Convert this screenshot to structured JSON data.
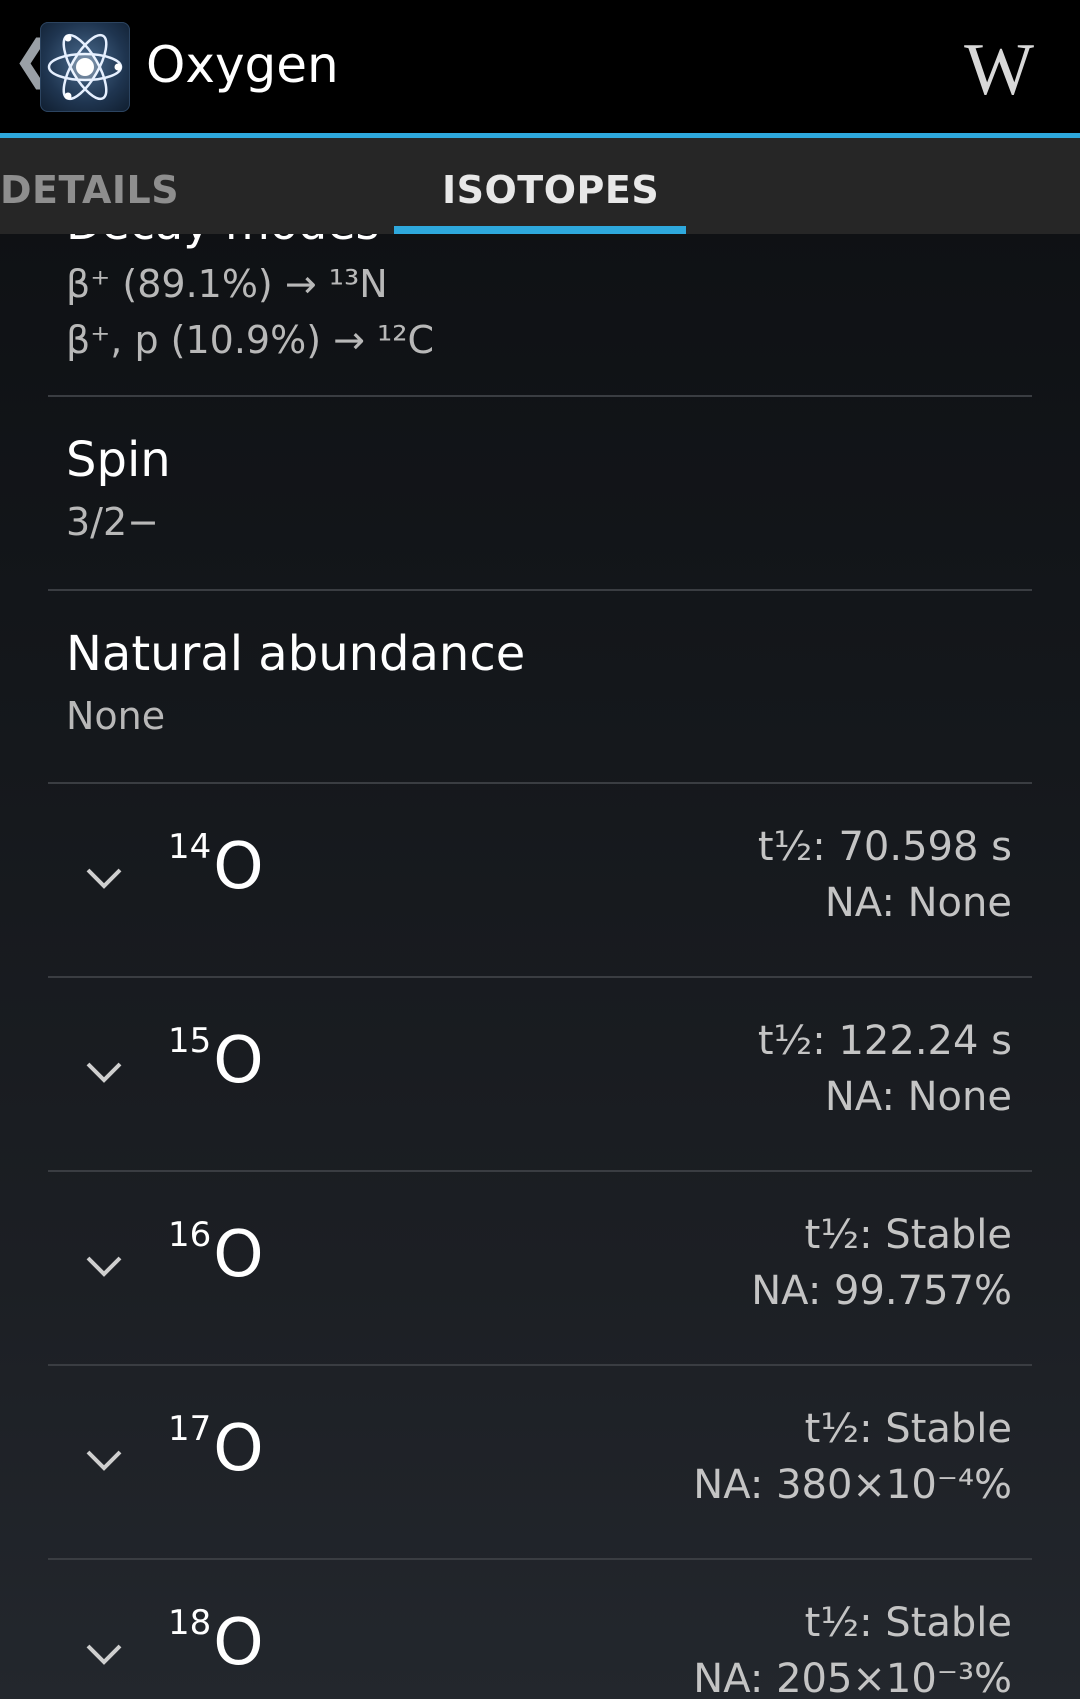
{
  "app": {
    "title": "Oxygen",
    "back_glyph": "❮",
    "app_icon": "atom-icon",
    "wiki_glyph": "W",
    "accent_color": "#2ea8dc"
  },
  "tabs": [
    {
      "label": "DETAILS",
      "selected": false
    },
    {
      "label": "ISOTOPES",
      "selected": true
    }
  ],
  "detail": {
    "decay_modes_label": "Decay modes",
    "decay_modes": [
      "β⁺ (89.1%) → ¹³N",
      "β⁺, p (10.9%) → ¹²C"
    ],
    "spin_label": "Spin",
    "spin_value": "3/2−",
    "abundance_label": "Natural abundance",
    "abundance_value": "None"
  },
  "isotopes": [
    {
      "mass": "14",
      "symbol": "O",
      "half_life": "t½: 70.598 s",
      "na": "NA: None"
    },
    {
      "mass": "15",
      "symbol": "O",
      "half_life": "t½: 122.24 s",
      "na": "NA: None"
    },
    {
      "mass": "16",
      "symbol": "O",
      "half_life": "t½: Stable",
      "na": "NA: 99.757%"
    },
    {
      "mass": "17",
      "symbol": "O",
      "half_life": "t½: Stable",
      "na": "NA: 380×10⁻⁴%"
    },
    {
      "mass": "18",
      "symbol": "O",
      "half_life": "t½: Stable",
      "na": "NA: 205×10⁻³%"
    }
  ]
}
